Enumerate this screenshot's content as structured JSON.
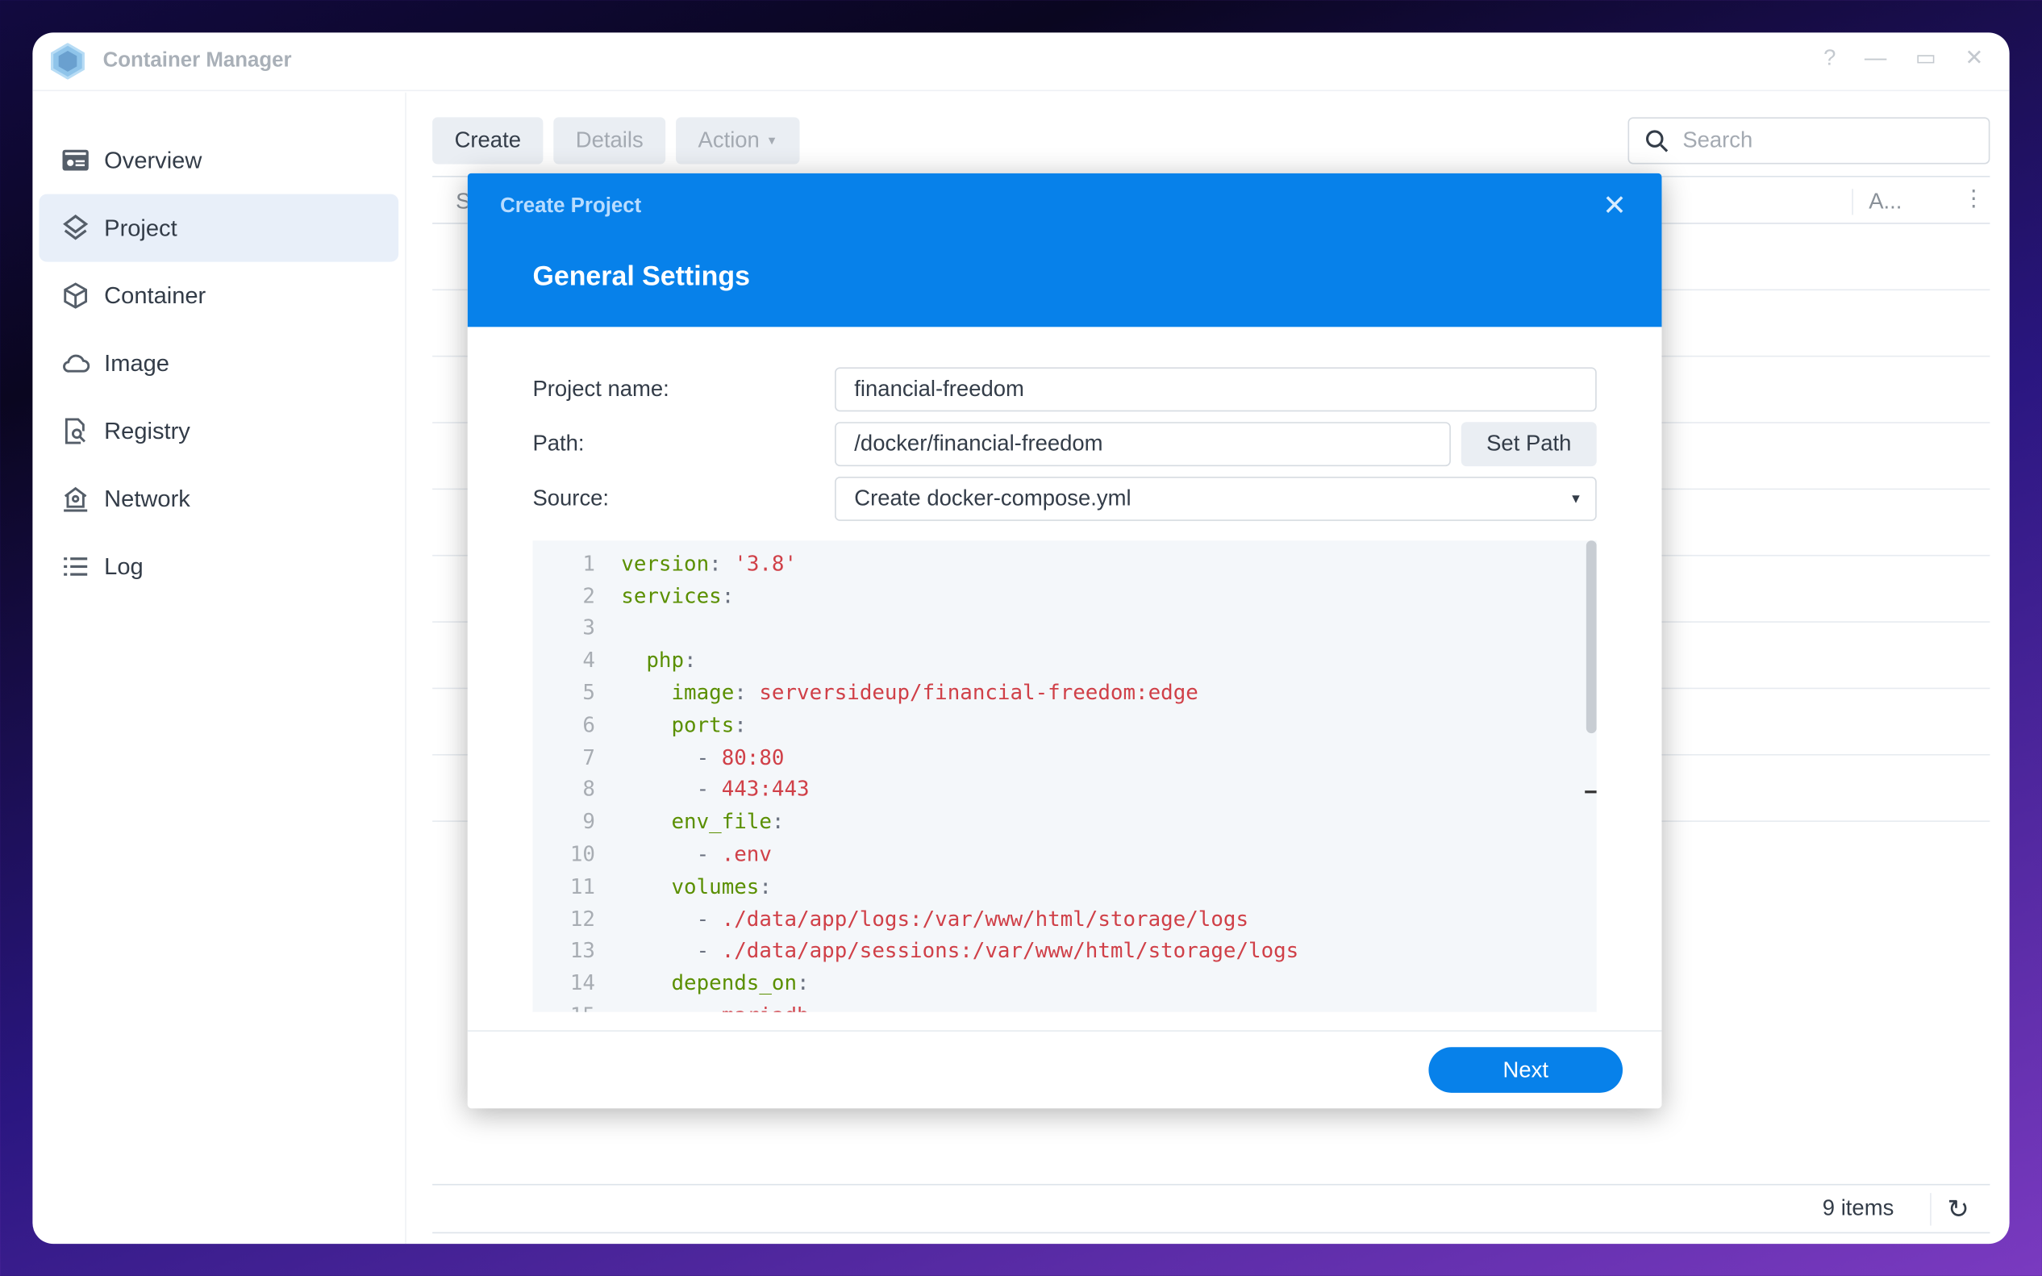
{
  "app": {
    "title": "Container Manager",
    "window_controls": [
      "?",
      "—",
      "▭",
      "✕"
    ]
  },
  "sidebar": {
    "items": [
      {
        "label": "Overview",
        "icon": "overview-icon"
      },
      {
        "label": "Project",
        "icon": "layers-icon",
        "active": true
      },
      {
        "label": "Container",
        "icon": "cube-icon"
      },
      {
        "label": "Image",
        "icon": "cloud-icon"
      },
      {
        "label": "Registry",
        "icon": "registry-icon"
      },
      {
        "label": "Network",
        "icon": "network-icon"
      },
      {
        "label": "Log",
        "icon": "list-icon"
      }
    ]
  },
  "toolbar": {
    "create": "Create",
    "details": "Details",
    "action": "Action",
    "search_placeholder": "Search"
  },
  "table": {
    "col_first": "S",
    "col_last": "A...",
    "item_count": "9 items"
  },
  "modal": {
    "title": "Create Project",
    "subtitle": "General Settings",
    "project_name_label": "Project name:",
    "project_name": "financial-freedom",
    "path_label": "Path:",
    "path": "/docker/financial-freedom",
    "set_path": "Set Path",
    "source_label": "Source:",
    "source": "Create docker-compose.yml",
    "code": [
      [
        [
          "k",
          "version"
        ],
        [
          "p",
          ": "
        ],
        [
          "v",
          "'3.8'"
        ]
      ],
      [
        [
          "k",
          "services"
        ],
        [
          "p",
          ":"
        ]
      ],
      [],
      [
        [
          "p",
          "  "
        ],
        [
          "k",
          "php"
        ],
        [
          "p",
          ":"
        ]
      ],
      [
        [
          "p",
          "    "
        ],
        [
          "k",
          "image"
        ],
        [
          "p",
          ": "
        ],
        [
          "v",
          "serversideup/financial-freedom:edge"
        ]
      ],
      [
        [
          "p",
          "    "
        ],
        [
          "k",
          "ports"
        ],
        [
          "p",
          ":"
        ]
      ],
      [
        [
          "p",
          "      - "
        ],
        [
          "v",
          "80:80"
        ]
      ],
      [
        [
          "p",
          "      - "
        ],
        [
          "v",
          "443:443"
        ]
      ],
      [
        [
          "p",
          "    "
        ],
        [
          "k",
          "env_file"
        ],
        [
          "p",
          ":"
        ]
      ],
      [
        [
          "p",
          "      - "
        ],
        [
          "v",
          ".env"
        ]
      ],
      [
        [
          "p",
          "    "
        ],
        [
          "k",
          "volumes"
        ],
        [
          "p",
          ":"
        ]
      ],
      [
        [
          "p",
          "      - "
        ],
        [
          "v",
          "./data/app/logs:/var/www/html/storage/logs"
        ]
      ],
      [
        [
          "p",
          "      - "
        ],
        [
          "v",
          "./data/app/sessions:/var/www/html/storage/logs"
        ]
      ],
      [
        [
          "p",
          "    "
        ],
        [
          "k",
          "depends_on"
        ],
        [
          "p",
          ":"
        ]
      ],
      [
        [
          "p",
          "      - "
        ],
        [
          "v",
          "mariadb"
        ]
      ]
    ],
    "next": "Next"
  },
  "colors": {
    "accent": "#0781ea",
    "key": "#5a8f00",
    "value": "#d04048"
  }
}
